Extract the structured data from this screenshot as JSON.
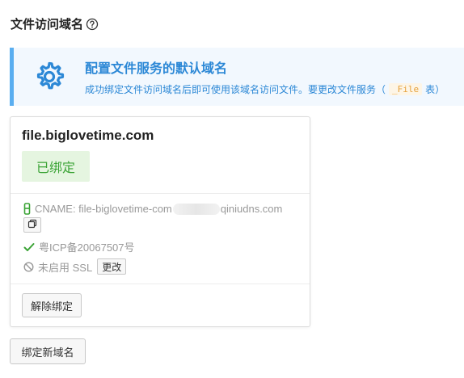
{
  "section": {
    "title": "文件访问域名"
  },
  "banner": {
    "title": "配置文件服务的默认域名",
    "desc_prefix": "成功绑定文件访问域名后即可使用该域名访问文件。要更改文件服务（",
    "code": "_File",
    "desc_suffix": "表）"
  },
  "card": {
    "domain": "file.biglovetime.com",
    "status": "已绑定",
    "cname_prefix": "CNAME: file-biglovetime-com",
    "cname_suffix": "qiniudns.com",
    "icp": "粤ICP备20067507号",
    "ssl_text": "未启用 SSL",
    "ssl_change_label": "更改",
    "unbind_label": "解除绑定"
  },
  "actions": {
    "bind_new_label": "绑定新域名"
  },
  "colors": {
    "accent": "#2c88d6",
    "banner_bg": "#f2f8fe",
    "banner_border": "#5aaef0",
    "success": "#3aa335",
    "success_bg": "#e5f5e0",
    "code": "#e6a23c"
  }
}
